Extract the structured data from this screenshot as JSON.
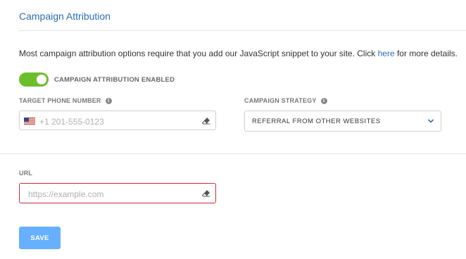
{
  "section": {
    "title": "Campaign Attribution"
  },
  "description": {
    "before": "Most campaign attribution options require that you add our JavaScript snippet to your site. Click ",
    "link": "here",
    "after": " for more details."
  },
  "toggle": {
    "label": "CAMPAIGN ATTRIBUTION ENABLED",
    "enabled": true,
    "color": "#6abf2a"
  },
  "phone": {
    "label": "TARGET PHONE NUMBER",
    "placeholder": "+1 201-555-0123",
    "value": "",
    "country": "US"
  },
  "strategy": {
    "label": "CAMPAIGN STRATEGY",
    "selected": "REFERRAL FROM OTHER WEBSITES"
  },
  "url": {
    "label": "URL",
    "placeholder": "https://example.com",
    "value": "",
    "error_color": "#cc2b3a"
  },
  "save": {
    "label": "SAVE",
    "color": "#66b0ff"
  },
  "colors": {
    "accent": "#2e6db4"
  }
}
